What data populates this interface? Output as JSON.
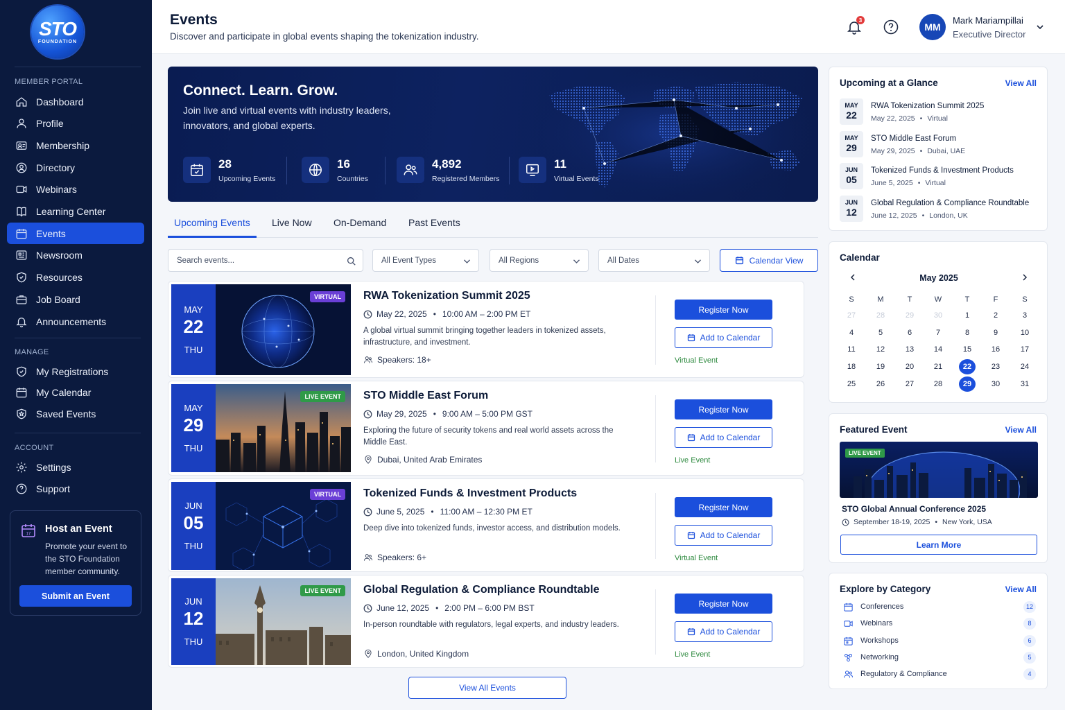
{
  "logo": {
    "text": "STO",
    "subtext": "FOUNDATION"
  },
  "sidebar": {
    "member_heading": "MEMBER PORTAL",
    "member_items": [
      {
        "label": "Dashboard",
        "icon": "home-icon"
      },
      {
        "label": "Profile",
        "icon": "user-icon"
      },
      {
        "label": "Membership",
        "icon": "id-card-icon"
      },
      {
        "label": "Directory",
        "icon": "user-circle-icon"
      },
      {
        "label": "Webinars",
        "icon": "video-icon"
      },
      {
        "label": "Learning Center",
        "icon": "book-icon"
      },
      {
        "label": "Events",
        "icon": "calendar-icon"
      },
      {
        "label": "Newsroom",
        "icon": "newspaper-icon"
      },
      {
        "label": "Resources",
        "icon": "shield-icon"
      },
      {
        "label": "Job Board",
        "icon": "briefcase-icon"
      },
      {
        "label": "Announcements",
        "icon": "bell-icon"
      }
    ],
    "manage_heading": "MANAGE",
    "manage_items": [
      {
        "label": "My Registrations",
        "icon": "badge-check-icon"
      },
      {
        "label": "My Calendar",
        "icon": "calendar-icon"
      },
      {
        "label": "Saved Events",
        "icon": "bookmark-icon"
      }
    ],
    "account_heading": "ACCOUNT",
    "account_items": [
      {
        "label": "Settings",
        "icon": "gear-icon"
      },
      {
        "label": "Support",
        "icon": "help-circle-icon"
      }
    ],
    "host": {
      "title": "Host an Event",
      "description": "Promote your event to the STO Foundation member community.",
      "button": "Submit an Event",
      "icon_day": "17"
    }
  },
  "header": {
    "title": "Events",
    "subtitle": "Discover and participate in global events shaping the tokenization industry.",
    "notification_count": "3",
    "user": {
      "initials": "MM",
      "name": "Mark Mariampillai",
      "role": "Executive Director"
    }
  },
  "hero": {
    "title": "Connect. Learn. Grow.",
    "subtitle": "Join live and virtual events with industry leaders, innovators, and global experts.",
    "stats": [
      {
        "value": "28",
        "label": "Upcoming Events",
        "icon": "calendar-check-icon"
      },
      {
        "value": "16",
        "label": "Countries",
        "icon": "globe-icon"
      },
      {
        "value": "4,892",
        "label": "Registered Members",
        "icon": "users-icon"
      },
      {
        "value": "11",
        "label": "Virtual Events",
        "icon": "monitor-play-icon"
      }
    ]
  },
  "tabs": [
    "Upcoming Events",
    "Live Now",
    "On-Demand",
    "Past Events"
  ],
  "filters": {
    "search_placeholder": "Search events...",
    "event_types": "All Event Types",
    "regions": "All Regions",
    "dates": "All Dates",
    "calendar_view": "Calendar View"
  },
  "events": [
    {
      "month": "MAY",
      "day": "22",
      "weekday": "THU",
      "tag": "VIRTUAL",
      "title": "RWA Tokenization Summit 2025",
      "date": "May 22, 2025",
      "time": "10:00 AM – 2:00 PM ET",
      "description": "A global virtual summit bringing together leaders in tokenized assets, infrastructure, and investment.",
      "extra": "Speakers: 18+",
      "extra_icon": "users-icon",
      "type": "Virtual Event",
      "register": "Register Now",
      "add_calendar": "Add to Calendar"
    },
    {
      "month": "MAY",
      "day": "29",
      "weekday": "THU",
      "tag": "LIVE EVENT",
      "title": "STO Middle East Forum",
      "date": "May 29, 2025",
      "time": "9:00 AM – 5:00 PM GST",
      "description": "Exploring the future of security tokens and real world assets across the Middle East.",
      "extra": "Dubai, United Arab Emirates",
      "extra_icon": "map-pin-icon",
      "type": "Live Event",
      "register": "Register Now",
      "add_calendar": "Add to Calendar"
    },
    {
      "month": "JUN",
      "day": "05",
      "weekday": "THU",
      "tag": "VIRTUAL",
      "title": "Tokenized Funds & Investment Products",
      "date": "June 5, 2025",
      "time": "11:00 AM – 12:30 PM ET",
      "description": "Deep dive into tokenized funds, investor access, and distribution models.",
      "extra": "Speakers: 6+",
      "extra_icon": "users-icon",
      "type": "Virtual Event",
      "register": "Register Now",
      "add_calendar": "Add to Calendar"
    },
    {
      "month": "JUN",
      "day": "12",
      "weekday": "THU",
      "tag": "LIVE EVENT",
      "title": "Global Regulation & Compliance Roundtable",
      "date": "June 12, 2025",
      "time": "2:00 PM – 6:00 PM BST",
      "description": "In-person roundtable with regulators, legal experts, and industry leaders.",
      "extra": "London, United Kingdom",
      "extra_icon": "map-pin-icon",
      "type": "Live Event",
      "register": "Register Now",
      "add_calendar": "Add to Calendar"
    }
  ],
  "view_all_events": "View All Events",
  "upcoming": {
    "title": "Upcoming at a Glance",
    "view_all": "View All",
    "items": [
      {
        "month": "MAY",
        "day": "22",
        "title": "RWA Tokenization Summit 2025",
        "date": "May 22, 2025",
        "place": "Virtual"
      },
      {
        "month": "MAY",
        "day": "29",
        "title": "STO Middle East Forum",
        "date": "May 29, 2025",
        "place": "Dubai, UAE"
      },
      {
        "month": "JUN",
        "day": "05",
        "title": "Tokenized Funds & Investment Products",
        "date": "June 5, 2025",
        "place": "Virtual"
      },
      {
        "month": "JUN",
        "day": "12",
        "title": "Global Regulation & Compliance Roundtable",
        "date": "June 12, 2025",
        "place": "London, UK"
      }
    ]
  },
  "calendar": {
    "title": "Calendar",
    "month": "May 2025",
    "weekdays": [
      "S",
      "M",
      "T",
      "W",
      "T",
      "F",
      "S"
    ],
    "days": [
      "27",
      "28",
      "29",
      "30",
      "1",
      "2",
      "3",
      "4",
      "5",
      "6",
      "7",
      "8",
      "9",
      "10",
      "11",
      "12",
      "13",
      "14",
      "15",
      "16",
      "17",
      "18",
      "19",
      "20",
      "21",
      "22",
      "23",
      "24",
      "25",
      "26",
      "27",
      "28",
      "29",
      "30",
      "31"
    ],
    "muted_days": 4,
    "selected": [
      "22",
      "29"
    ]
  },
  "featured": {
    "title": "Featured Event",
    "view_all": "View All",
    "tag": "LIVE EVENT",
    "event_title": "STO Global Annual Conference 2025",
    "date": "September 18-19, 2025",
    "place": "New York, USA",
    "button": "Learn More"
  },
  "categories": {
    "title": "Explore by Category",
    "view_all": "View All",
    "items": [
      {
        "label": "Conferences",
        "count": "12",
        "icon": "calendar-icon"
      },
      {
        "label": "Webinars",
        "count": "8",
        "icon": "video-icon"
      },
      {
        "label": "Workshops",
        "count": "6",
        "icon": "workshop-icon"
      },
      {
        "label": "Networking",
        "count": "5",
        "icon": "network-icon"
      },
      {
        "label": "Regulatory & Compliance",
        "count": "4",
        "icon": "users-icon"
      }
    ]
  },
  "colors": {
    "primary": "#1b4fdc",
    "sidebar": "#0b1a3e",
    "hero": "#0d2260",
    "live": "#2f9a48",
    "virtual": "#6a3fd6"
  }
}
